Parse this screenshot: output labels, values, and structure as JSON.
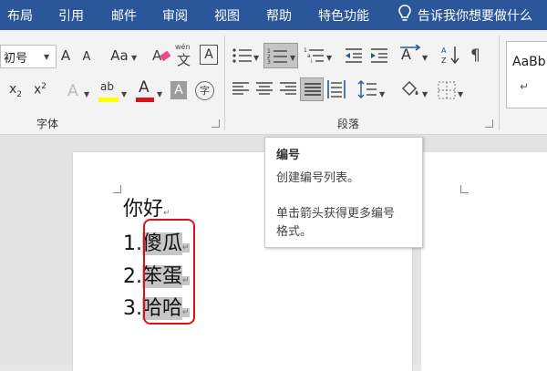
{
  "menu": [
    "布局",
    "引用",
    "邮件",
    "审阅",
    "视图",
    "帮助",
    "特色功能"
  ],
  "tell_me": "告诉我你想要做什么",
  "font": {
    "size_value": "初号",
    "grow": "A",
    "shrink": "A",
    "case": "Aa",
    "phonetic": "文",
    "phonetic_top": "wén",
    "border_char": "A",
    "subscript": "x",
    "subscript_mark": "2",
    "superscript": "x",
    "superscript_mark": "2",
    "effects": "A",
    "highlight": "ab",
    "font_color": "A",
    "shading": "A",
    "enclose": "字",
    "group_label": "字体"
  },
  "paragraph": {
    "group_label": "段落"
  },
  "styles": {
    "preview": "AaBb",
    "mark": "↵"
  },
  "tooltip": {
    "title": "编号",
    "line1": "创建编号列表。",
    "line2": "单击箭头获得更多编号",
    "line3": "格式。"
  },
  "document": {
    "line0": "你好",
    "items": [
      {
        "num": "1.",
        "text": "傻瓜"
      },
      {
        "num": "2.",
        "text": "笨蛋"
      },
      {
        "num": "3.",
        "text": "哈哈"
      }
    ],
    "para_mark": "↵"
  },
  "colors": {
    "ribbon_blue": "#2b579a",
    "highlight_yellow": "#ffff00",
    "font_red": "#e0101a",
    "callout_red": "#e0101a"
  }
}
